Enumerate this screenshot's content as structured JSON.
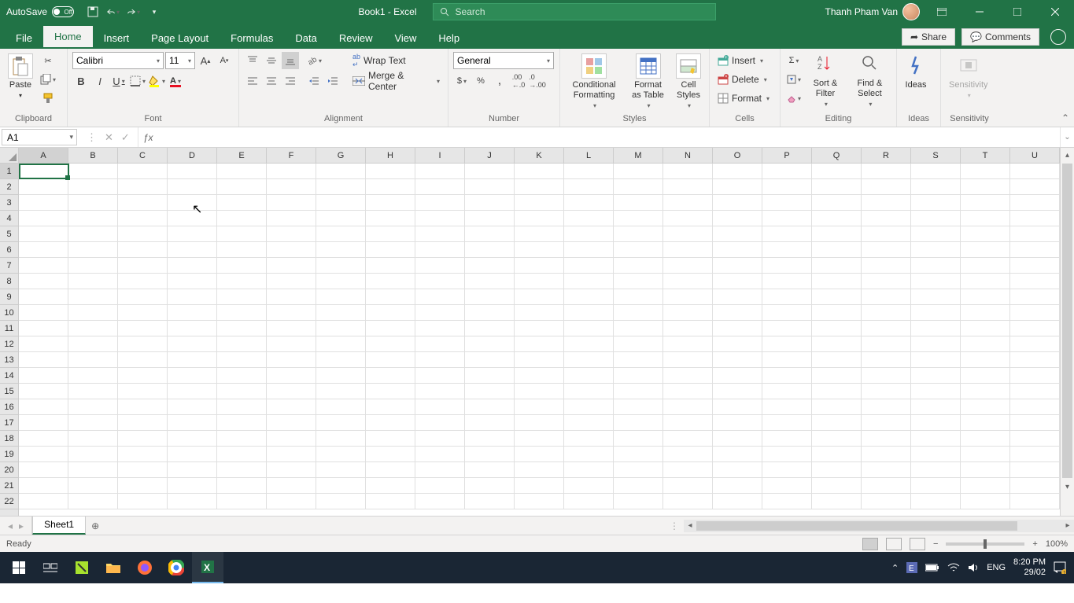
{
  "titlebar": {
    "autosave_label": "AutoSave",
    "autosave_state": "Off",
    "doc_title": "Book1 - Excel",
    "search_placeholder": "Search",
    "user_name": "Thanh Pham Van"
  },
  "tabs": {
    "file": "File",
    "home": "Home",
    "insert": "Insert",
    "page_layout": "Page Layout",
    "formulas": "Formulas",
    "data": "Data",
    "review": "Review",
    "view": "View",
    "help": "Help",
    "share": "Share",
    "comments": "Comments"
  },
  "ribbon": {
    "clipboard": {
      "label": "Clipboard",
      "paste": "Paste"
    },
    "font": {
      "label": "Font",
      "name": "Calibri",
      "size": "11"
    },
    "alignment": {
      "label": "Alignment",
      "wrap": "Wrap Text",
      "merge": "Merge & Center"
    },
    "number": {
      "label": "Number",
      "format": "General"
    },
    "styles": {
      "label": "Styles",
      "cond": "Conditional Formatting",
      "table": "Format as Table",
      "cell": "Cell Styles"
    },
    "cells": {
      "label": "Cells",
      "insert": "Insert",
      "delete": "Delete",
      "format": "Format"
    },
    "editing": {
      "label": "Editing",
      "sort": "Sort & Filter",
      "find": "Find & Select"
    },
    "ideas": {
      "label": "Ideas",
      "btn": "Ideas"
    },
    "sensitivity": {
      "label": "Sensitivity",
      "btn": "Sensitivity"
    }
  },
  "formula": {
    "name_box": "A1",
    "value": ""
  },
  "grid": {
    "columns": [
      "A",
      "B",
      "C",
      "D",
      "E",
      "F",
      "G",
      "H",
      "I",
      "J",
      "K",
      "L",
      "M",
      "N",
      "O",
      "P",
      "Q",
      "R",
      "S",
      "T",
      "U"
    ],
    "rows": [
      "1",
      "2",
      "3",
      "4",
      "5",
      "6",
      "7",
      "8",
      "9",
      "10",
      "11",
      "12",
      "13",
      "14",
      "15",
      "16",
      "17",
      "18",
      "19",
      "20",
      "21",
      "22"
    ],
    "selected": "A1"
  },
  "sheets": {
    "active": "Sheet1"
  },
  "status": {
    "ready": "Ready",
    "zoom": "100%"
  },
  "taskbar": {
    "lang": "ENG",
    "time": "8:20 PM",
    "date": "29/02"
  }
}
